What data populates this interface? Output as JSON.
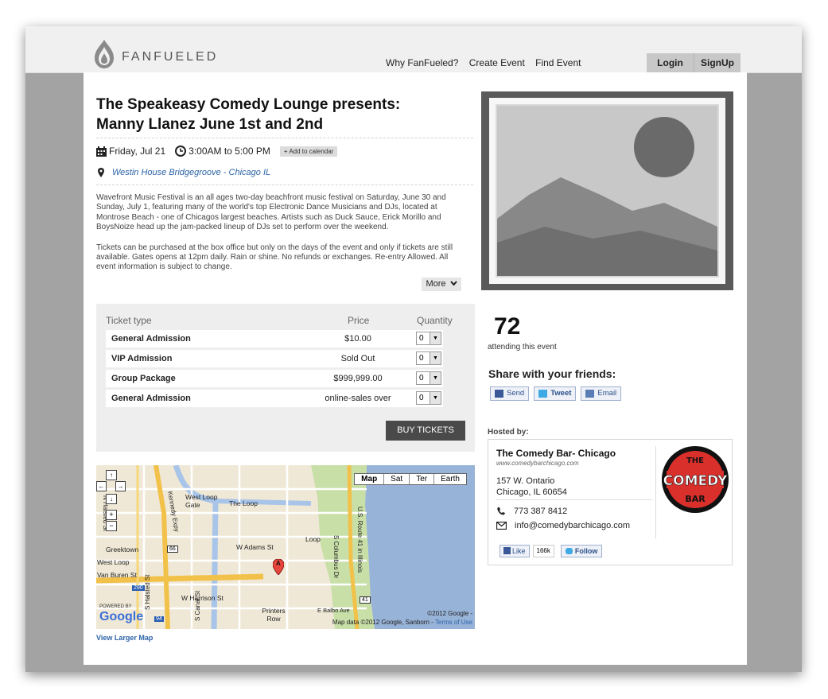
{
  "header": {
    "brand": "FANFUELED",
    "nav": [
      "Why FanFueled?",
      "Create Event",
      "Find Event"
    ],
    "login": "Login",
    "signup": "SignUp"
  },
  "event": {
    "title_line1": "The Speakeasy Comedy Lounge presents:",
    "title_line2": "Manny Llanez June 1st and 2nd",
    "date": "Friday, Jul 21",
    "time": "3:00AM to 5:00 PM",
    "add_calendar": "+ Add to calendar",
    "venue": "Westin House Bridgegroove - Chicago IL",
    "description": [
      "Wavefront Music Festival is an all ages two-day beachfront music festival on Saturday, June 30 and Sunday, July 1, featuring many of the world's top Electronic Dance Musicians and DJs, located at Montrose Beach - one of Chicagos largest beaches.  Artists such as Duck Sauce, Erick Morillo and BoysNoize head up the jam-packed lineup of DJs set to perform over the weekend.",
      "Tickets can be purchased at the box office but only on the days of the event and only if tickets are still available. Gates opens at 12pm daily. Rain or shine. No refunds or exchanges. Re-entry Allowed. All event information is subject to change."
    ],
    "more": "More"
  },
  "tickets": {
    "headers": {
      "type": "Ticket type",
      "price": "Price",
      "quantity": "Quantity"
    },
    "rows": [
      {
        "name": "General Admission",
        "price": "$10.00",
        "qty": "0"
      },
      {
        "name": "VIP Admission",
        "price": "Sold Out",
        "qty": "0"
      },
      {
        "name": "Group Package",
        "price": "$999,999.00",
        "qty": "0"
      },
      {
        "name": "General Admission",
        "price": "online-sales over",
        "qty": "0"
      }
    ],
    "buy": "BUY TICKETS"
  },
  "map": {
    "types": [
      "Map",
      "Sat",
      "Ter",
      "Earth"
    ],
    "copyright": "©2012 Google -",
    "data_credit": "Map data ©2012 Google, Sanborn -",
    "terms": "Terms of Use",
    "powered": "POWERED BY",
    "google": "Google",
    "labels": {
      "west_loop_gate": "West Loop Gate",
      "the_loop": "The Loop",
      "w_adams": "W Adams St",
      "loop": "Loop",
      "greektown": "Greektown",
      "west_loop": "West Loop",
      "van_buren": "Van Buren St",
      "w_harrison": "W Harrison St",
      "printers_row": "Printers Row",
      "e_balbo": "E Balbo Ave",
      "n_halsted": "N Halsted St",
      "kennedy": "Kennedy Expy",
      "columbus": "S Columbus Dr",
      "us_route_41": "U.S. Route 41 in Illinois",
      "s_halsted": "S Halsted St",
      "s_canal": "S Canal St"
    },
    "shields": [
      "66",
      "290",
      "94",
      "41"
    ],
    "pin": "A",
    "larger": "View Larger Map"
  },
  "attendance": {
    "count": "72",
    "label": "attending this event"
  },
  "share": {
    "title": "Share with your friends:",
    "buttons": [
      "Send",
      "Tweet",
      "Email"
    ]
  },
  "host": {
    "label": "Hosted by:",
    "name": "The Comedy Bar- Chicago",
    "url": "www.comedybarchicago.com",
    "address1": "157 W. Ontario",
    "address2": "Chicago, IL 60654",
    "phone": "773 387 8412",
    "email": "info@comedybarchicago.com",
    "like": "Like",
    "like_count": "166k",
    "follow": "Follow",
    "logo_top": "THE",
    "logo_mid": "COMEDY",
    "logo_bottom": "BAR"
  },
  "colors": {
    "logo_red": "#d9302c",
    "link": "#2a63a8",
    "frame": "#a3a3a3"
  }
}
